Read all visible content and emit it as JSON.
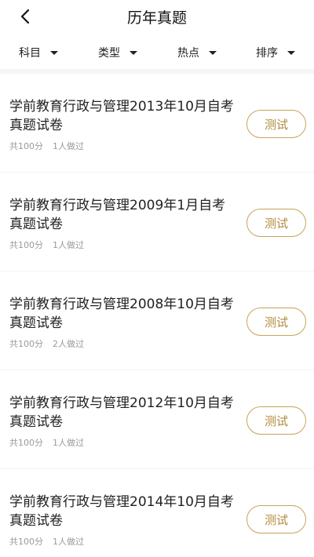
{
  "header": {
    "title": "历年真题"
  },
  "filters": [
    {
      "label": "科目"
    },
    {
      "label": "类型"
    },
    {
      "label": "热点"
    },
    {
      "label": "排序"
    }
  ],
  "items": [
    {
      "title": "学前教育行政与管理2013年10月自考真题试卷",
      "score": "共100分",
      "done": "1人做过",
      "button": "测试"
    },
    {
      "title": "学前教育行政与管理2009年1月自考真题试卷",
      "score": "共100分",
      "done": "1人做过",
      "button": "测试"
    },
    {
      "title": "学前教育行政与管理2008年10月自考真题试卷",
      "score": "共100分",
      "done": "2人做过",
      "button": "测试"
    },
    {
      "title": "学前教育行政与管理2012年10月自考真题试卷",
      "score": "共100分",
      "done": "1人做过",
      "button": "测试"
    },
    {
      "title": "学前教育行政与管理2014年10月自考真题试卷",
      "score": "共100分",
      "done": "1人做过",
      "button": "测试"
    }
  ]
}
